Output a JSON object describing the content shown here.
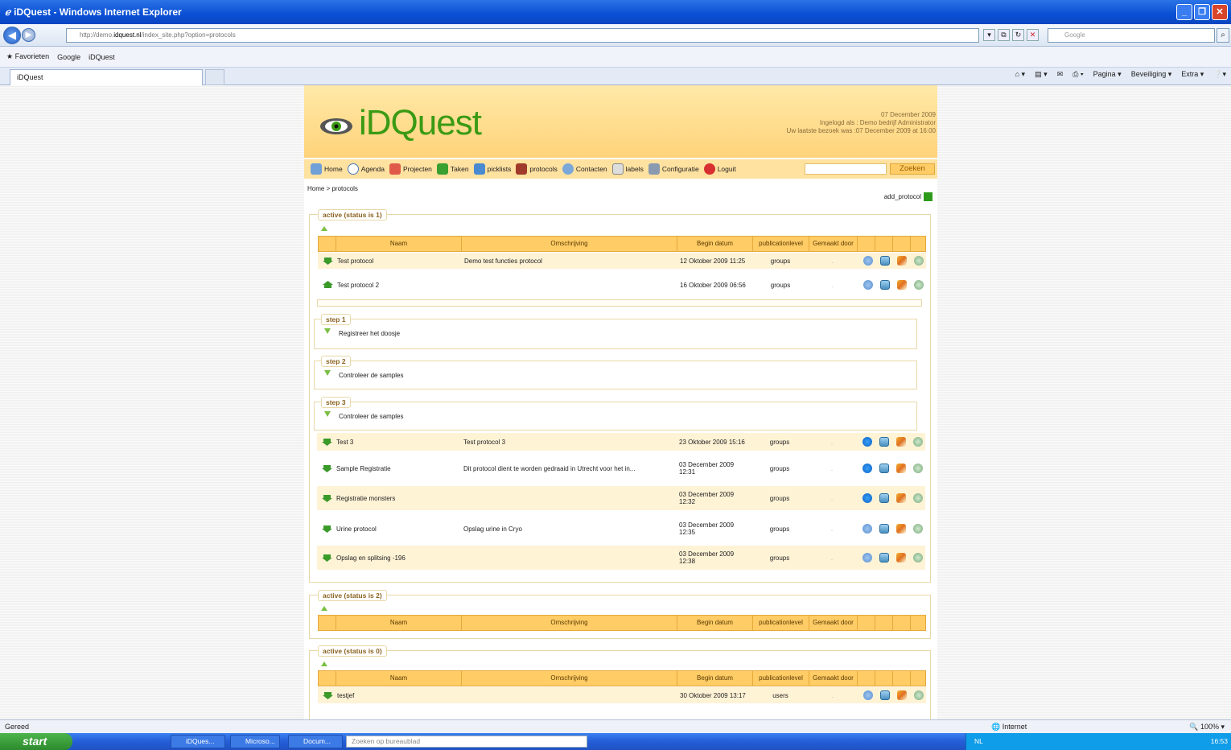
{
  "window": {
    "title": "iDQuest - Windows Internet Explorer"
  },
  "address": {
    "url_prefix": "http://demo.",
    "url_domain": "idquest.nl",
    "url_suffix": "/index_site.php?option=protocols",
    "search_placeholder": "Google"
  },
  "favorites": {
    "label": "Favorieten",
    "items": [
      "Google",
      "iDQuest"
    ]
  },
  "tab": {
    "title": "iDQuest"
  },
  "commands": {
    "pagina": "Pagina ▾",
    "beveiliging": "Beveiliging ▾",
    "extra": "Extra ▾"
  },
  "header": {
    "logo": "iDQuest",
    "date": "07 December 2009",
    "logged_in": "Ingelogd als : Demo bedrijf Administrator",
    "last_visit": "Uw laatste bezoek was :07 December 2009 at 16:00"
  },
  "menu": {
    "home": "Home",
    "agenda": "Agenda",
    "projecten": "Projecten",
    "taken": "Taken",
    "picklists": "picklists",
    "protocols": "protocols",
    "contacten": "Contacten",
    "labels": "labels",
    "configuratie": "Configuratie",
    "loguit": "Loguit",
    "zoeken": "Zoeken"
  },
  "breadcrumb": "Home > protocols",
  "add_protocol": "add_protocol",
  "columns": {
    "naam": "Naam",
    "omschrijving": "Omschrijving",
    "begin": "Begin datum",
    "publication": "publicationlevel",
    "gemaakt": "Gemaakt door"
  },
  "sections": {
    "active1": "active (status is 1)",
    "active2": "active (status is 2)",
    "active0": "active (status is 0)"
  },
  "rows": [
    {
      "naam": "Test protocol",
      "omschrijving": "Demo test functies protocol",
      "begin": "12 Oktober 2009 11:25",
      "pub": "groups",
      "gemaakt": "."
    },
    {
      "naam": "Test protocol 2",
      "omschrijving": "",
      "begin": "16 Oktober 2009 06:56",
      "pub": "groups",
      "gemaakt": "."
    },
    {
      "naam": "Test 3",
      "omschrijving": "Test protocol 3",
      "begin": "23 Oktober 2009 15:16",
      "pub": "groups",
      "gemaakt": "."
    },
    {
      "naam": "Sample Registratie",
      "omschrijving": "Dit protocol dient te worden gedraaid in Utrecht voor het in...",
      "begin": "03 December 2009 12:31",
      "pub": "groups",
      "gemaakt": "."
    },
    {
      "naam": "Registratie monsters",
      "omschrijving": "",
      "begin": "03 December 2009 12:32",
      "pub": "groups",
      "gemaakt": "."
    },
    {
      "naam": "Urine protocol",
      "omschrijving": "Opslag urine in Cryo",
      "begin": "03 December 2009 12:35",
      "pub": "groups",
      "gemaakt": "."
    },
    {
      "naam": "Opslag en splitsing -196",
      "omschrijving": "",
      "begin": "03 December 2009 12:38",
      "pub": "groups",
      "gemaakt": "."
    }
  ],
  "steps": [
    {
      "label": "step 1",
      "text": "Registreer het doosje"
    },
    {
      "label": "step 2",
      "text": "Controleer de samples"
    },
    {
      "label": "step 3",
      "text": "Controleer de samples"
    }
  ],
  "status0_row": {
    "naam": "testjef",
    "begin": "30 Oktober 2009 13:17",
    "pub": "users",
    "gemaakt": "."
  },
  "statusbar": {
    "text": "Gereed",
    "zone": "Internet",
    "zoom": "100%"
  },
  "taskbar": {
    "start": "start",
    "buttons": [
      "iDQues...",
      "Microso...",
      "Docum..."
    ],
    "search": "Zoeken op bureaublad",
    "lang": "NL",
    "clock": "16:53"
  }
}
